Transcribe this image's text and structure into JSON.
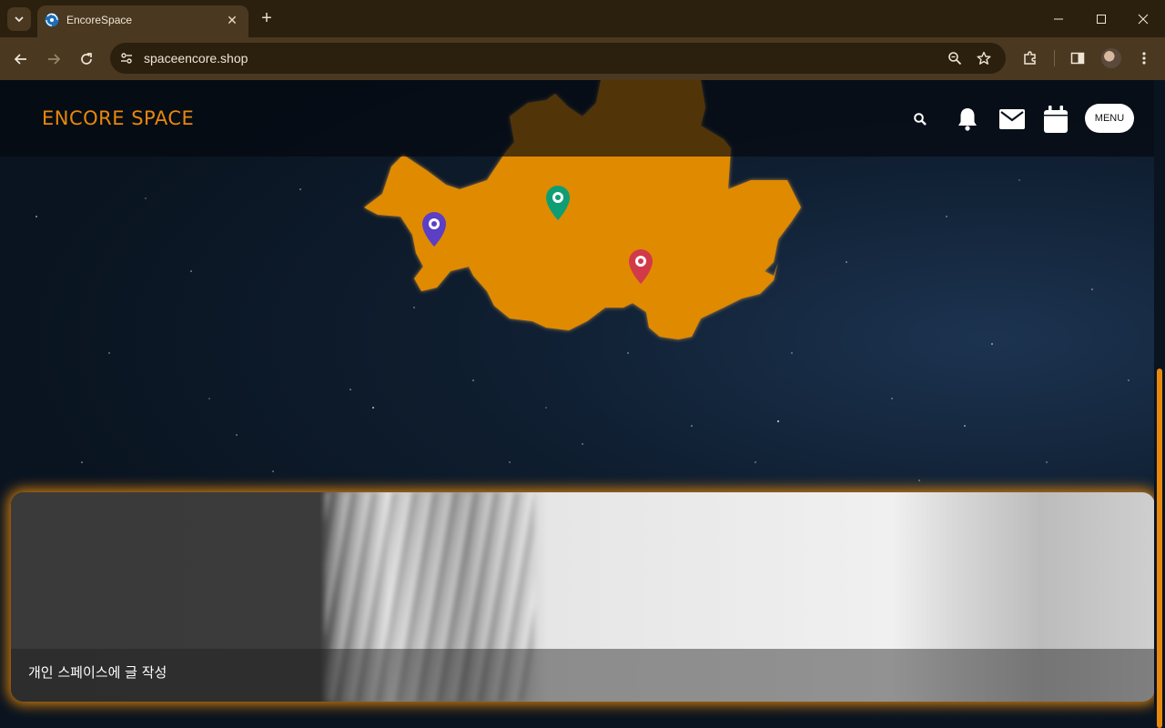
{
  "browser": {
    "tab_title": "EncoreSpace",
    "url": "spaceencore.shop",
    "tab_close": "✕",
    "new_tab": "+"
  },
  "site": {
    "logo": "ENCORE SPACE",
    "menu_label": "MENU"
  },
  "map": {
    "region_color": "#e08a00",
    "pins": [
      {
        "name": "purple-pin",
        "color": "#5b3fc4"
      },
      {
        "name": "green-pin",
        "color": "#0e9e74"
      },
      {
        "name": "red-pin",
        "color": "#d23a4a"
      }
    ]
  },
  "card": {
    "caption": "개인 스페이스에 글 작성"
  },
  "colors": {
    "accent": "#e8880c",
    "chrome_dark": "#2b1f0e",
    "chrome_mid": "#4a3820"
  }
}
